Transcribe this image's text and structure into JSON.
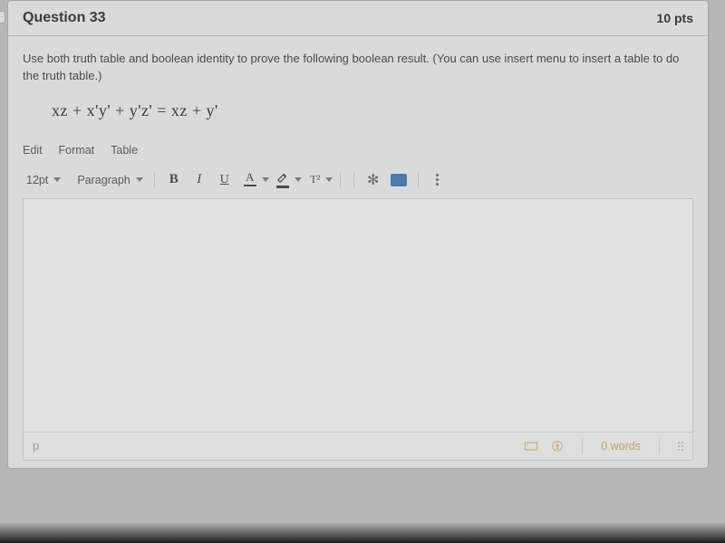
{
  "header": {
    "title": "Question 33",
    "points": "10 pts"
  },
  "prompt": "Use both truth table and boolean identity to prove the following boolean result. (You can use insert menu to insert a table to do the truth table.)",
  "equation": "xz + x'y' + y'z' = xz + y'",
  "menubar": {
    "edit": "Edit",
    "format": "Format",
    "table": "Table"
  },
  "toolbar": {
    "font_size": "12pt",
    "block": "Paragraph",
    "bold": "B",
    "italic": "I",
    "underline": "U",
    "textcolor_letter": "A",
    "superscript": "T²"
  },
  "status": {
    "tag": "p",
    "words": "0 words"
  }
}
